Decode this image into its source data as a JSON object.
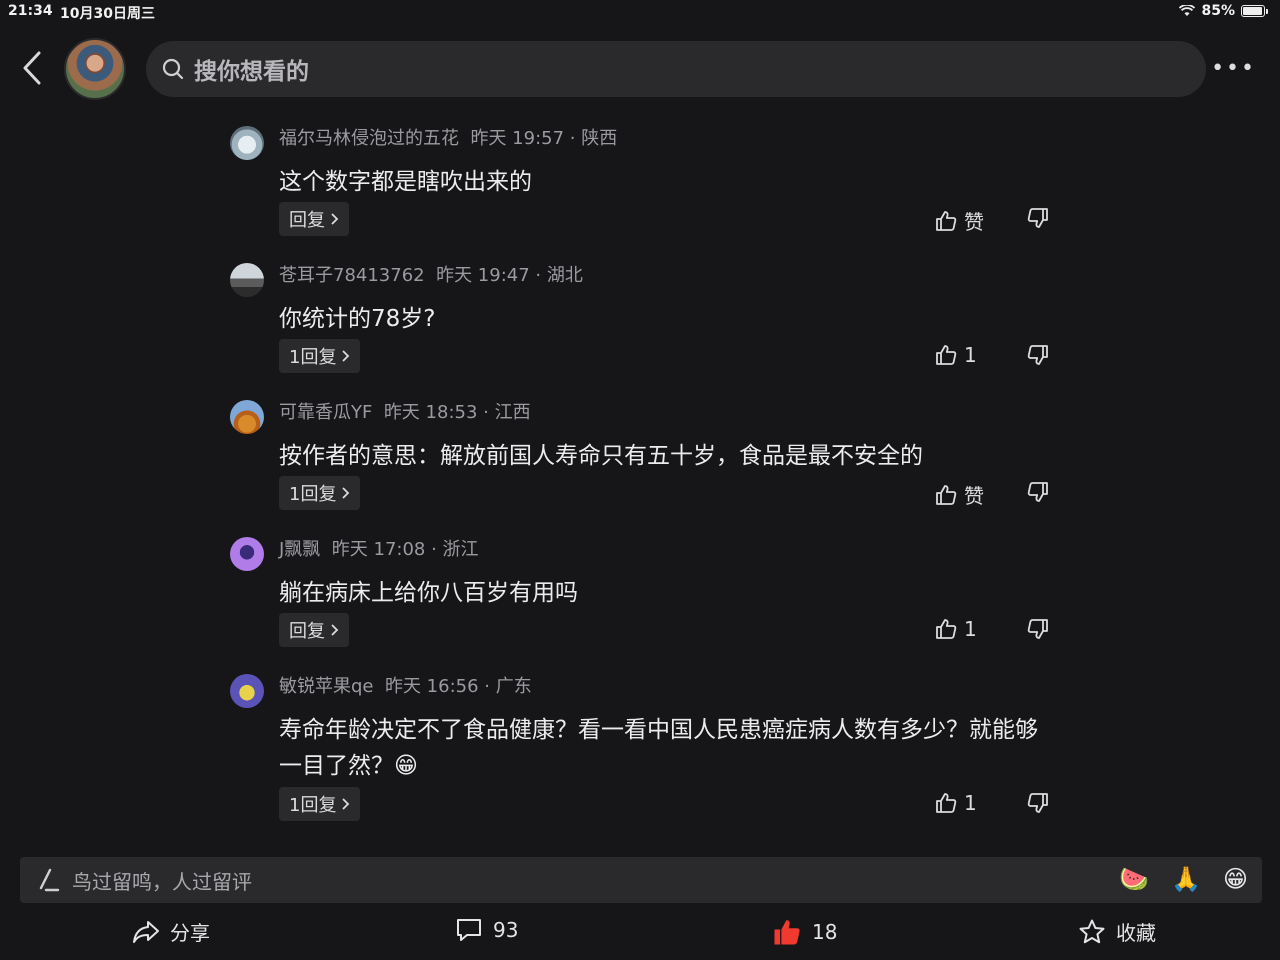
{
  "status_bar": {
    "time": "21:34",
    "date": "10月30日周三",
    "battery": "85%"
  },
  "header": {
    "search_placeholder": "搜你想看的"
  },
  "comments": [
    {
      "user": "福尔马林侵泡过的五花",
      "time": "昨天 19:57",
      "location": "陕西",
      "text": "这个数字都是瞎吹出来的",
      "reply_label": "回复",
      "like_label": "赞"
    },
    {
      "user": "苍耳子78413762",
      "time": "昨天 19:47",
      "location": "湖北",
      "text": "你统计的78岁?",
      "reply_label": "1回复",
      "like_label": "1"
    },
    {
      "user": "可靠香瓜YF",
      "time": "昨天 18:53",
      "location": "江西",
      "text": "按作者的意思：解放前国人寿命只有五十岁，食品是最不安全的",
      "reply_label": "1回复",
      "like_label": "赞"
    },
    {
      "user": "J飘飘",
      "time": "昨天 17:08",
      "location": "浙江",
      "text": "躺在病床上给你八百岁有用吗",
      "reply_label": "回复",
      "like_label": "1"
    },
    {
      "user": "敏锐苹果qe",
      "time": "昨天 16:56",
      "location": "广东",
      "text": "寿命年龄决定不了食品健康？看一看中国人民患癌症病人数有多少？就能够一目了然？😁",
      "reply_label": "1回复",
      "like_label": "1"
    }
  ],
  "input_bar": {
    "placeholder": "鸟过留鸣，人过留评",
    "emojis": [
      "🍉",
      "🙏",
      "😁"
    ]
  },
  "bottom_bar": {
    "share_label": "分享",
    "comment_count": "93",
    "like_count": "18",
    "favorite_label": "收藏"
  },
  "colors": {
    "background": "#161618",
    "like_active": "#f03a2f",
    "input_bg": "#2a2a2d"
  },
  "icons": [
    "back-icon",
    "search-icon",
    "more-icon",
    "thumb-up-icon",
    "thumb-down-icon",
    "chevron-right-icon",
    "pen-icon",
    "share-icon",
    "comment-icon",
    "star-icon"
  ]
}
